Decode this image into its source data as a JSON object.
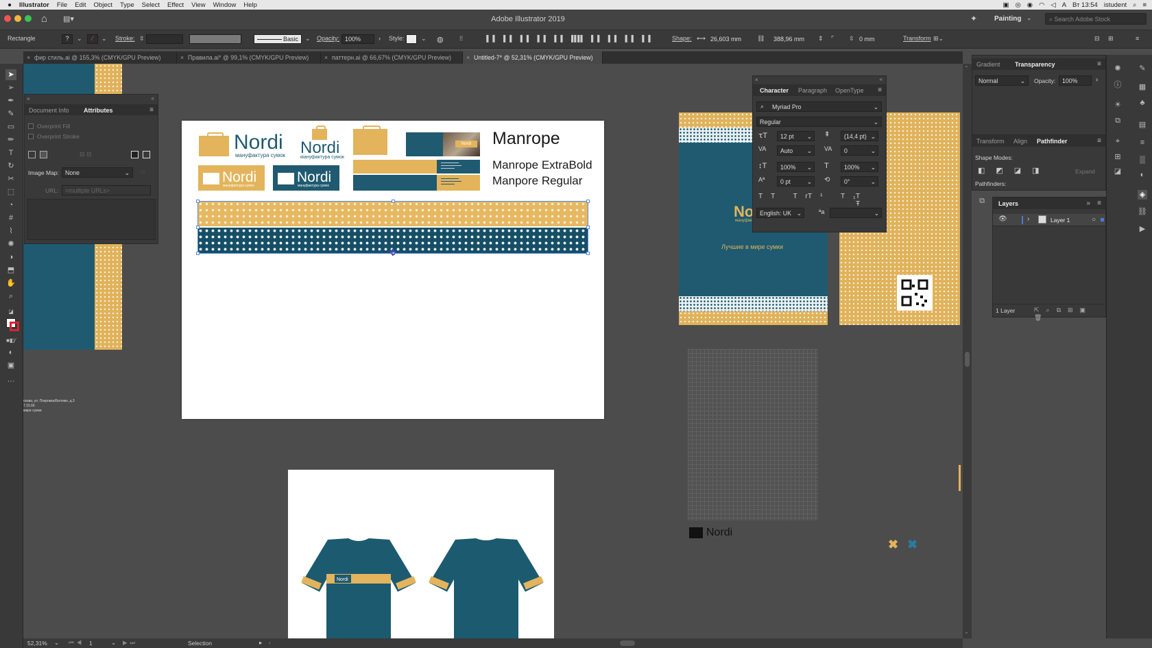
{
  "menubar": {
    "apple": "",
    "app": "Illustrator",
    "items": [
      "File",
      "Edit",
      "Object",
      "Type",
      "Select",
      "Effect",
      "View",
      "Window",
      "Help"
    ],
    "clock": "Вт 13:54",
    "user": "istudent"
  },
  "titlebar": {
    "title": "Adobe Illustrator 2019",
    "workspace": "Painting",
    "search_placeholder": "Search Adobe Stock"
  },
  "control": {
    "object_type": "Rectangle",
    "stroke_label": "Stroke:",
    "brush": "Basic",
    "opacity_label": "Opacity:",
    "opacity": "100%",
    "style_label": "Style:",
    "shape_label": "Shape:",
    "width": "26,603 mm",
    "height": "388,96 mm",
    "corner": "0 mm",
    "transform": "Transform"
  },
  "tabs": [
    {
      "label": "фир стиль.ai @ 155,3% (CMYK/GPU Preview)"
    },
    {
      "label": "Правила.ai* @ 99,1% (CMYK/GPU Preview)"
    },
    {
      "label": "паттерн.ai @ 66,67% (CMYK/GPU Preview)"
    },
    {
      "label": "Untitled-7* @ 52,31% (CMYK/GPU Preview)"
    }
  ],
  "attributes_panel": {
    "tab1": "Document Info",
    "tab2": "Attributes",
    "overprint_fill": "Overprint Fill",
    "overprint_stroke": "Overprint Stroke",
    "image_map_label": "Image Map:",
    "image_map_value": "None",
    "url_label": "URL:",
    "url_value": "<multiple URLs>"
  },
  "character_panel": {
    "tab1": "Character",
    "tab2": "Paragraph",
    "tab3": "OpenType",
    "font": "Myriad Pro",
    "style": "Regular",
    "size": "12 pt",
    "leading": "(14,4 pt)",
    "kerning": "Auto",
    "tracking": "0",
    "vscale": "100%",
    "hscale": "100%",
    "baseline": "0 pt",
    "rotation": "0°",
    "language": "English: UK",
    "aa": "ªa"
  },
  "gradient_panel": {
    "tab1": "Gradient",
    "tab2": "Transparency",
    "blend": "Normal",
    "opacity_label": "Opacity:",
    "opacity": "100%"
  },
  "pathfinder_panel": {
    "tab1": "Transform",
    "tab2": "Align",
    "tab3": "Pathfinder",
    "shape_modes": "Shape Modes:",
    "expand": "Expand",
    "pathfinders": "Pathfinders:"
  },
  "layers_panel": {
    "tab": "Layers",
    "layer_name": "Layer 1",
    "count": "1 Layer"
  },
  "artboard": {
    "logo_main": "Nordi",
    "logo_sub": "мануфактура сумок",
    "font_title": "Manrope",
    "font_line1": "Manrope ExtraBold",
    "font_line2": "Manpore Regular"
  },
  "side_art": {
    "tagline": "Лучшие в мире сумки",
    "partial_brand": "Nor",
    "address": "осква, ул. Покровка/Беломо, д.3",
    "address2": "7.15.66",
    "address3": "мире сумки"
  },
  "status": {
    "zoom": "52,31%",
    "page": "1",
    "tool": "Selection"
  },
  "colors": {
    "mustard": "#e3b45b",
    "teal": "#1f5a70"
  }
}
